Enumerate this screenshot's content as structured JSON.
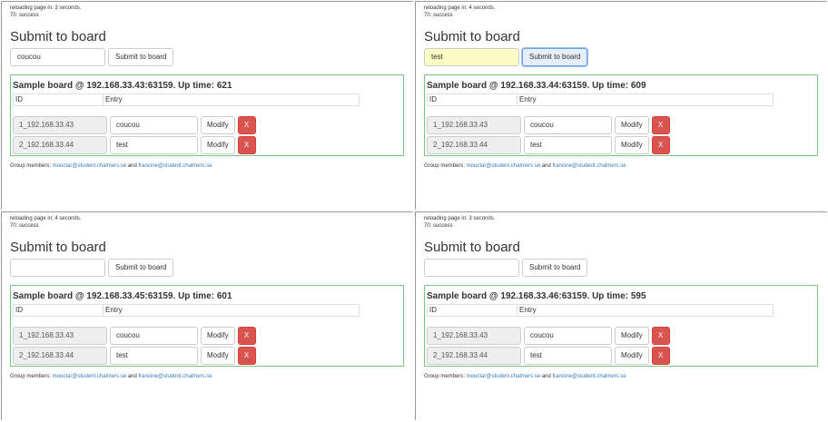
{
  "panels": [
    {
      "reload": "reloading page in: 3 seconds.",
      "status": "70: success",
      "heading": "Submit to board",
      "input_value": "coucou",
      "submit_label": "Submit to board",
      "board_title": "Sample board @ 192.168.33.43:63159. Up time: 621",
      "col_id": "ID",
      "col_entry": "Entry",
      "rows": [
        {
          "id": "1_192.168.33.43",
          "entry": "coucou",
          "modify": "Modify",
          "delete": "X"
        },
        {
          "id": "2_192.168.33.44",
          "entry": "test",
          "modify": "Modify",
          "delete": "X"
        }
      ],
      "footer_prefix": "Group members:",
      "member1": "mouctar@student.chalmers.se",
      "footer_and": "and",
      "member2": "francine@student.chalmers.se"
    },
    {
      "reload": "reloading page in: 4 seconds.",
      "status": "70: success",
      "heading": "Submit to board",
      "input_value": "test",
      "submit_label": "Submit to board",
      "board_title": "Sample board @ 192.168.33.44:63159. Up time: 609",
      "col_id": "ID",
      "col_entry": "Entry",
      "rows": [
        {
          "id": "1_192.168.33.43",
          "entry": "coucou",
          "modify": "Modify",
          "delete": "X"
        },
        {
          "id": "2_192.168.33.44",
          "entry": "test",
          "modify": "Modify",
          "delete": "X"
        }
      ],
      "footer_prefix": "Group members:",
      "member1": "mouctar@student.chalmers.se",
      "footer_and": "and",
      "member2": "francine@student.chalmers.se"
    },
    {
      "reload": "reloading page in: 4 seconds.",
      "status": "70: success",
      "heading": "Submit to board",
      "input_value": "",
      "submit_label": "Submit to board",
      "board_title": "Sample board @ 192.168.33.45:63159. Up time: 601",
      "col_id": "ID",
      "col_entry": "Entry",
      "rows": [
        {
          "id": "1_192.168.33.43",
          "entry": "coucou",
          "modify": "Modify",
          "delete": "X"
        },
        {
          "id": "2_192.168.33.44",
          "entry": "test",
          "modify": "Modify",
          "delete": "X"
        }
      ],
      "footer_prefix": "Group members:",
      "member1": "mouctar@student.chalmers.se",
      "footer_and": "and",
      "member2": "francine@student.chalmers.se"
    },
    {
      "reload": "reloading page in: 3 seconds.",
      "status": "70: success",
      "heading": "Submit to board",
      "input_value": "",
      "submit_label": "Submit to board",
      "board_title": "Sample board @ 192.168.33.46:63159. Up time: 595",
      "col_id": "ID",
      "col_entry": "Entry",
      "rows": [
        {
          "id": "1_192.168.33.43",
          "entry": "coucou",
          "modify": "Modify",
          "delete": "X"
        },
        {
          "id": "2_192.168.33.44",
          "entry": "test",
          "modify": "Modify",
          "delete": "X"
        }
      ],
      "footer_prefix": "Group members:",
      "member1": "mouctar@student.chalmers.se",
      "footer_and": "and",
      "member2": "francine@student.chalmers.se"
    }
  ],
  "colors": {
    "board_border": "#7cc47f",
    "delete_button": "#d9534f",
    "input_highlight": "#fbfbc4",
    "link": "#337ab7"
  }
}
